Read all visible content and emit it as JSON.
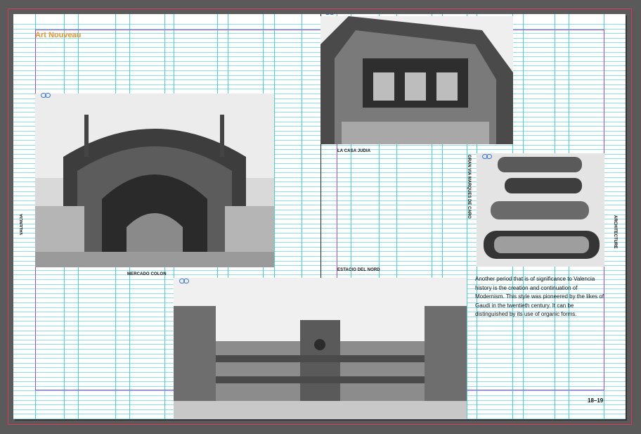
{
  "document": {
    "title": "Art Nouveau",
    "folio": "18–19",
    "side_label_left": "VALENCIA",
    "side_label_right": "ARCHITECTURE"
  },
  "captions": {
    "mercado": "MERCADO COLON",
    "casa": "LA CASA JUDIA",
    "estacio": "ESTACIO DEL NORD",
    "gran_via": "GRAN VIA MARQUES DE CARO"
  },
  "body_text": "Another period that is of significance to Valencia history is the creation and continuation of Modernism. This style was pioneered by the likes of Gaudi in the twentieth century. It can be distinguished by its use of organic forms.",
  "colors": {
    "title": "#e8952c",
    "guide": "#2fc7d6",
    "margin": "#a64bc7",
    "bleed": "#d63a5a",
    "pasteboard": "#5a5a5a"
  },
  "icons": {
    "link": "link-icon"
  }
}
